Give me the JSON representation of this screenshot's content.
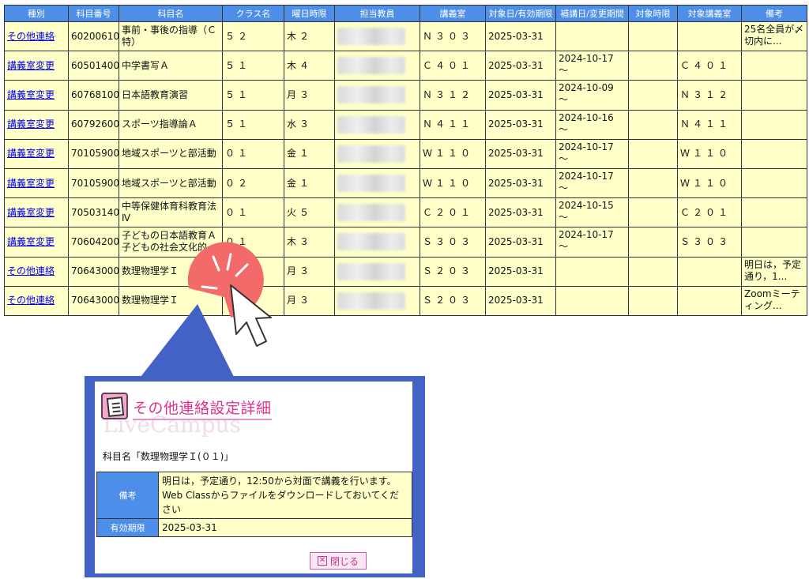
{
  "table": {
    "headers": [
      "種別",
      "科目番号",
      "科目名",
      "クラス名",
      "曜日時限",
      "担当教員",
      "講義室",
      "対象日/有効期限",
      "補講日/変更期間",
      "対象時限",
      "対象講義室",
      "備考"
    ],
    "rows": [
      {
        "type": "その他連絡",
        "code": "60200610",
        "subject": "事前・事後の指導（Ｃ特）",
        "class": "５２",
        "period": "木２",
        "room": "Ｎ３０３",
        "due": "2025-03-31",
        "change": "",
        "target_period": "",
        "target_room": "",
        "note": "25名全員が〆切内に..."
      },
      {
        "type": "講義室変更",
        "code": "60501400",
        "subject": "中学書写Ａ",
        "class": "５１",
        "period": "木４",
        "room": "Ｃ４０１",
        "due": "2025-03-31",
        "change": "2024-10-17 ～",
        "target_period": "",
        "target_room": "Ｃ４０１",
        "note": ""
      },
      {
        "type": "講義室変更",
        "code": "60768100",
        "subject": "日本語教育演習",
        "class": "５１",
        "period": "月３",
        "room": "Ｎ３１２",
        "due": "2025-03-31",
        "change": "2024-10-09 ～",
        "target_period": "",
        "target_room": "Ｎ３１２",
        "note": ""
      },
      {
        "type": "講義室変更",
        "code": "60792600",
        "subject": "スポーツ指導論Ａ",
        "class": "５１",
        "period": "水３",
        "room": "Ｎ４１１",
        "due": "2025-03-31",
        "change": "2024-10-16 ～",
        "target_period": "",
        "target_room": "Ｎ４１１",
        "note": ""
      },
      {
        "type": "講義室変更",
        "code": "70105900",
        "subject": "地域スポーツと部活動",
        "class": "０１",
        "period": "金１",
        "room": "Ｗ１１０",
        "due": "2025-03-31",
        "change": "2024-10-17 ～",
        "target_period": "",
        "target_room": "Ｗ１１０",
        "note": ""
      },
      {
        "type": "講義室変更",
        "code": "70105900",
        "subject": "地域スポーツと部活動",
        "class": "０２",
        "period": "金１",
        "room": "Ｗ１１０",
        "due": "2025-03-31",
        "change": "2024-10-17 ～",
        "target_period": "",
        "target_room": "Ｗ１１０",
        "note": ""
      },
      {
        "type": "講義室変更",
        "code": "70503140",
        "subject": "中等保健体育科教育法Ⅳ",
        "class": "０１",
        "period": "火５",
        "room": "Ｃ２０１",
        "due": "2025-03-31",
        "change": "2024-10-15 ～",
        "target_period": "",
        "target_room": "Ｃ２０１",
        "note": ""
      },
      {
        "type": "講義室変更",
        "code": "70604200",
        "subject": "子どもの日本語教育Ａ 子どもの社会文化的",
        "class": "０１",
        "period": "木３",
        "room": "Ｓ３０３",
        "due": "2025-03-31",
        "change": "2024-10-17 ～",
        "target_period": "",
        "target_room": "Ｓ３０３",
        "note": ""
      },
      {
        "type": "その他連絡",
        "code": "70643000",
        "subject": "数理物理学Ｉ",
        "class": "",
        "period": "月３",
        "room": "Ｓ２０３",
        "due": "2025-03-31",
        "change": "",
        "target_period": "",
        "target_room": "",
        "note": "明日は，予定通り，1..."
      },
      {
        "type": "その他連絡",
        "code": "70643000",
        "subject": "数理物理学Ｉ",
        "class": "０１",
        "period": "月３",
        "room": "Ｓ２０３",
        "due": "2025-03-31",
        "change": "",
        "target_period": "",
        "target_room": "",
        "note": "Zoomミーティング..."
      }
    ]
  },
  "dialog": {
    "title": "その他連絡設定詳細",
    "watermark": "LiveCampus",
    "subject_line": "科目名「数理物理学Ｉ(０１)」",
    "note_label": "備考",
    "note_line1": "明日は，予定通り，12:50から対面で講義を行います。",
    "note_line2": "Web Classからファイルをダウンロードしておいてください",
    "due_label": "有効期限",
    "due_value": "2025-03-31",
    "close_label": "閉じる"
  },
  "colors": {
    "header_bg": "#4d8ee8",
    "cell_bg": "#ffffc8",
    "link": "#0000ee",
    "callout_blue": "#4262c6",
    "click_marker": "#f26a6a",
    "dialog_title": "#e0338a"
  },
  "icons": {
    "cursor": "arrow-cursor-icon",
    "click": "click-burst-icon",
    "document": "document-icon",
    "close": "close-x-icon"
  }
}
